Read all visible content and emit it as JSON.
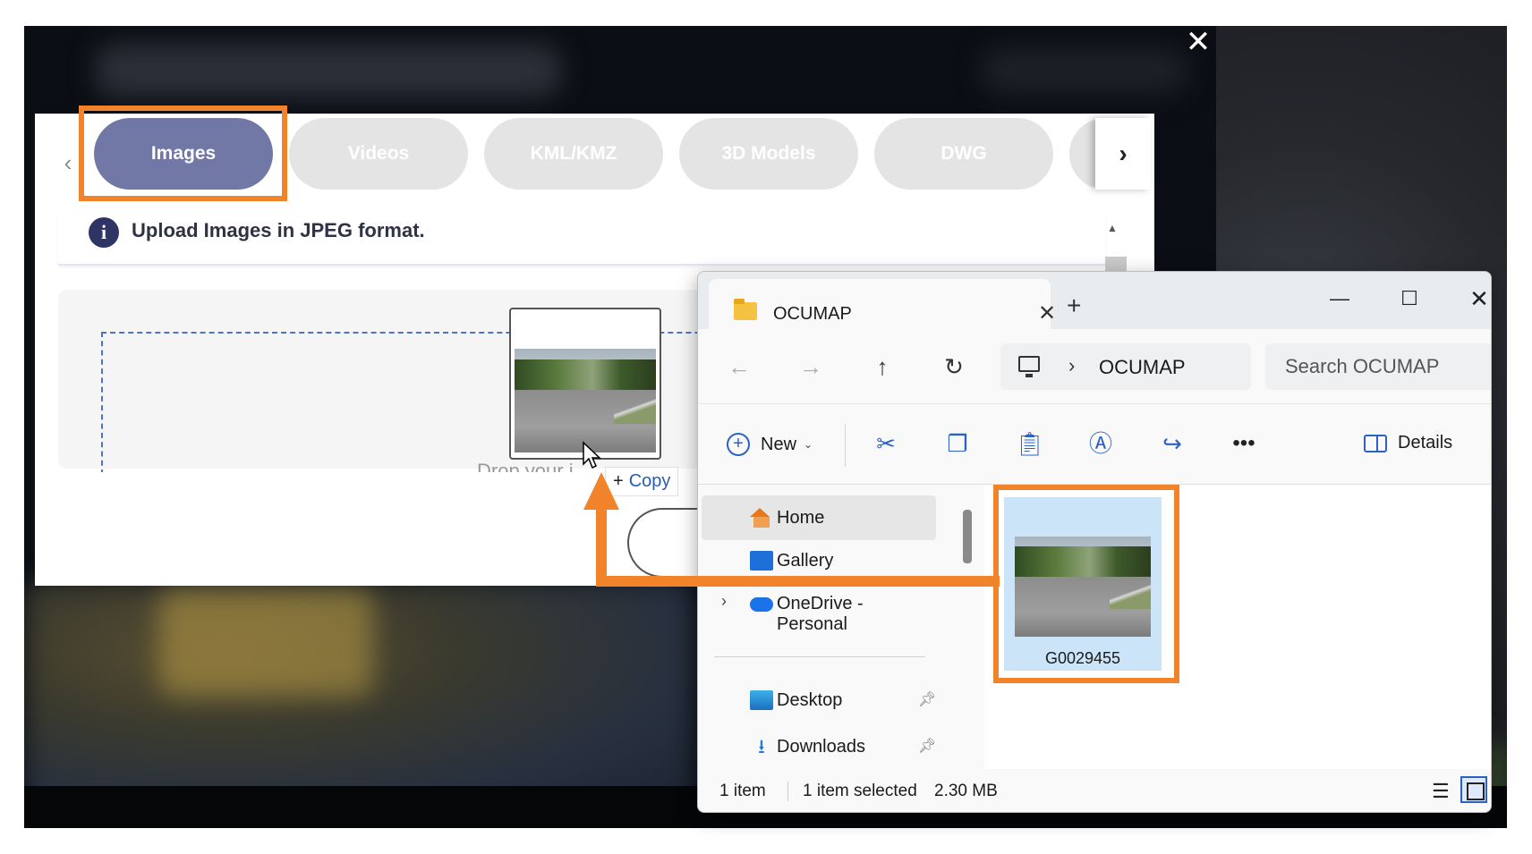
{
  "colors": {
    "accent_orange": "#f1842a",
    "tab_active": "#7278a6",
    "tab_inactive": "#e4e4e4",
    "info_icon": "#2e3565",
    "drop_border": "#4b73c9",
    "explorer_selection": "#cce4f7"
  },
  "overlay": {
    "close_icon": "close-icon"
  },
  "upload_dialog": {
    "tabs": [
      {
        "label": "Images",
        "active": true
      },
      {
        "label": "Videos",
        "active": false
      },
      {
        "label": "KML/KMZ",
        "active": false
      },
      {
        "label": "3D Models",
        "active": false
      },
      {
        "label": "DWG",
        "active": false
      }
    ],
    "prev_arrow_icon": "chevron-left-icon",
    "next_arrow_icon": "chevron-right-icon",
    "info_icon": "info-icon",
    "info_text": "Upload Images in JPEG format.",
    "drop_text": "Drop your i",
    "drag_copy_label": "Copy"
  },
  "explorer": {
    "tab_title": "OCUMAP",
    "window_buttons": [
      "minimize-icon",
      "maximize-icon",
      "close-icon"
    ],
    "address": {
      "location_icon": "this-pc-icon",
      "path": "OCUMAP"
    },
    "search": {
      "placeholder": "Search OCUMAP"
    },
    "command_bar": {
      "new_label": "New",
      "details_label": "Details",
      "icons": [
        "cut-icon",
        "copy-icon",
        "paste-icon",
        "rename-icon",
        "share-icon",
        "more-icon"
      ]
    },
    "navigation": [
      {
        "label": "Home",
        "icon": "home-icon",
        "selected": true
      },
      {
        "label": "Gallery",
        "icon": "gallery-icon"
      },
      {
        "label": "OneDrive - Personal",
        "icon": "onedrive-icon",
        "expandable": true
      },
      {
        "label": "Desktop",
        "icon": "desktop-icon",
        "pinned": true
      },
      {
        "label": "Downloads",
        "icon": "downloads-icon",
        "pinned": true
      }
    ],
    "files": [
      {
        "name": "G0029455",
        "selected": true
      }
    ],
    "status": {
      "count": "1 item",
      "selected": "1 item selected",
      "size": "2.30 MB"
    }
  }
}
